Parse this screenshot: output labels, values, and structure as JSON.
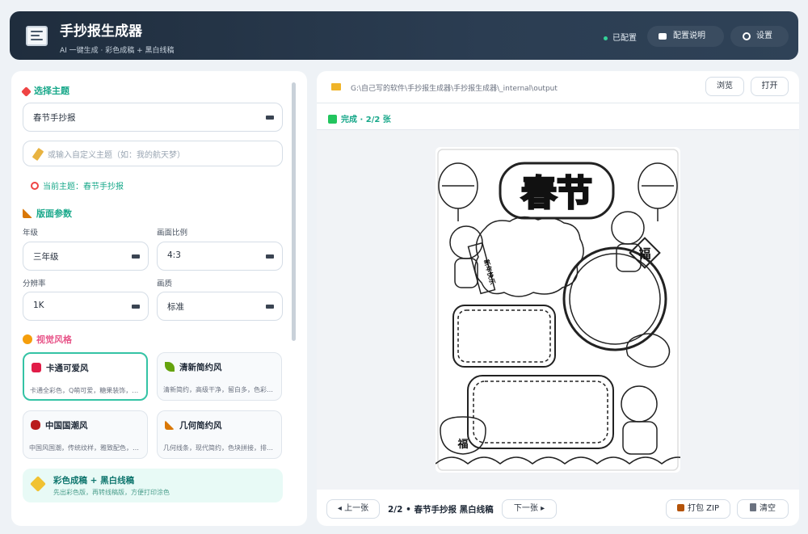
{
  "header": {
    "title": "手抄报生成器",
    "subtitle": "AI 一键生成 · 彩色成稿 + 黑白线稿",
    "status": "已配置",
    "config_help": "配置说明",
    "settings": "设置"
  },
  "theme": {
    "section_title": "选择主题",
    "selected": "春节手抄报",
    "custom_placeholder": "或输入自定义主题（如：我的航天梦）",
    "current": "当前主题：春节手抄报"
  },
  "layout_params": {
    "section_title": "版面参数",
    "grade_label": "年级",
    "grade_value": "三年级",
    "ratio_label": "画面比例",
    "ratio_value": "4:3",
    "resolution_label": "分辨率",
    "resolution_value": "1K",
    "quality_label": "画质",
    "quality_value": "标准"
  },
  "visual_style": {
    "section_title": "视觉风格",
    "styles": [
      {
        "title": "卡通可爱风",
        "desc": "卡通全彩色，Q萌可爱，糖果装饰，…",
        "selected": true,
        "icon": "bow-icon",
        "color": "#e11d48"
      },
      {
        "title": "清新简约风",
        "desc": "清新简约，高级干净，留白多，色彩…",
        "selected": false,
        "icon": "leaf-icon",
        "color": "#65a30d"
      },
      {
        "title": "中国国潮风",
        "desc": "中国风国潮，传统纹样，雅致配色，…",
        "selected": false,
        "icon": "lantern-icon",
        "color": "#b91c1c"
      },
      {
        "title": "几何简约风",
        "desc": "几何线条，现代简约，色块拼接，排…",
        "selected": false,
        "icon": "ruler-icon",
        "color": "#d97706"
      }
    ],
    "combo_title": "彩色成稿 + 黑白线稿",
    "combo_desc": "先出彩色版，再转线稿版，方便打印涂色"
  },
  "output": {
    "path": "G:\\自己写的软件\\手抄报生成器\\手抄报生成器\\_internal\\output",
    "browse": "浏览",
    "open": "打开",
    "done_text": "完成 · 2/2 张"
  },
  "poster": {
    "title": "春节",
    "fu": "福",
    "scroll_text": "新年快乐"
  },
  "footer": {
    "prev": "◂ 上一张",
    "page_info": "2/2 • 春节手抄报 黑白线稿",
    "next": "下一张 ▸",
    "zip": "打包 ZIP",
    "clear": "清空"
  }
}
